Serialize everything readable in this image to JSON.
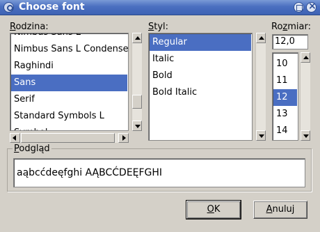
{
  "window": {
    "title": "Choose font"
  },
  "family": {
    "label_prefix": "R",
    "label_rest": "odzina:",
    "items": [
      "Nimbus Sans L",
      "Nimbus Sans L Condense",
      "Raghindi",
      "Sans",
      "Serif",
      "Standard Symbols L",
      "Symbol"
    ],
    "selected": "Sans"
  },
  "style": {
    "label_prefix": "S",
    "label_rest": "tyl:",
    "items": [
      "Regular",
      "Italic",
      "Bold",
      "Bold Italic"
    ],
    "selected": "Regular"
  },
  "size": {
    "label_prefix": "Ro",
    "label_mnemonic": "z",
    "label_rest": "miar:",
    "value": "12,0",
    "items": [
      "10",
      "11",
      "12",
      "13",
      "14"
    ],
    "selected": "12"
  },
  "preview": {
    "label_prefix": "P",
    "label_rest": "odgląd",
    "text": "aąbcćdeęfghi AĄBCĆDEĘFGHI"
  },
  "buttons": {
    "ok_mnemonic": "O",
    "ok_rest": "K",
    "cancel_mnemonic": "A",
    "cancel_rest": "nuluj"
  },
  "colors": {
    "selection": "#4a6ec2",
    "titlebar": "#4a6fc0",
    "dialog_bg": "#d4d0c8"
  }
}
